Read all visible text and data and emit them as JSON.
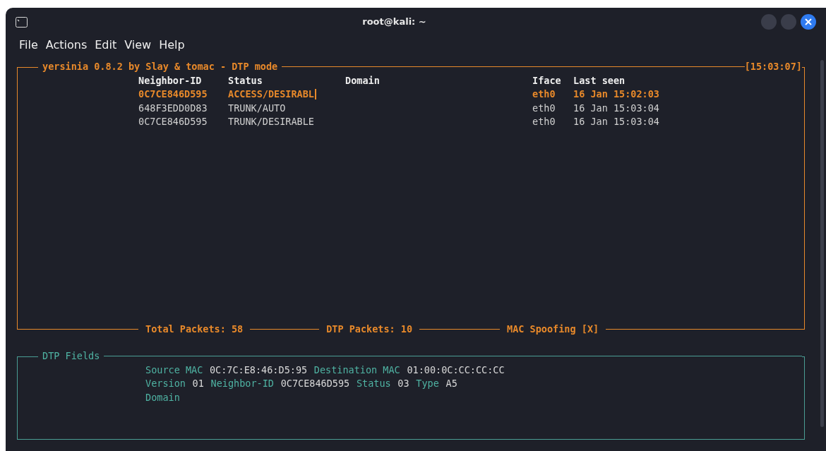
{
  "window": {
    "title": "root@kali: ~"
  },
  "menu": [
    "File",
    "Actions",
    "Edit",
    "View",
    "Help"
  ],
  "main_panel": {
    "title": "yersinia 0.8.2 by Slay & tomac - DTP mode",
    "clock": "[15:03:07]",
    "columns": [
      "Neighbor-ID",
      "Status",
      "Domain",
      "Iface",
      "Last seen"
    ],
    "rows": [
      {
        "neighbor_id": "0C7CE846D595",
        "status": "ACCESS/DESIRABL",
        "iface": "eth0",
        "last_seen": "16 Jan 15:02:03",
        "selected": true
      },
      {
        "neighbor_id": "648F3EDD0D83",
        "status": "TRUNK/AUTO",
        "iface": "eth0",
        "last_seen": "16 Jan 15:03:04",
        "selected": false
      },
      {
        "neighbor_id": "0C7CE846D595",
        "status": "TRUNK/DESIRABLE",
        "iface": "eth0",
        "last_seen": "16 Jan 15:03:04",
        "selected": false
      }
    ],
    "footer": [
      "Total Packets: 58",
      "DTP Packets: 10",
      "MAC Spoofing [X]"
    ]
  },
  "fields_panel": {
    "title": "DTP Fields",
    "lines": [
      [
        {
          "label": "Source MAC",
          "value": "0C:7C:E8:46:D5:95"
        },
        {
          "label": "Destination MAC",
          "value": "01:00:0C:CC:CC:CC"
        }
      ],
      [
        {
          "label": "Version",
          "value": "01"
        },
        {
          "label": "Neighbor-ID",
          "value": "0C7CE846D595"
        },
        {
          "label": "Status",
          "value": "03"
        },
        {
          "label": "Type",
          "value": "A5"
        }
      ],
      [
        {
          "label": "Domain"
        }
      ]
    ]
  }
}
